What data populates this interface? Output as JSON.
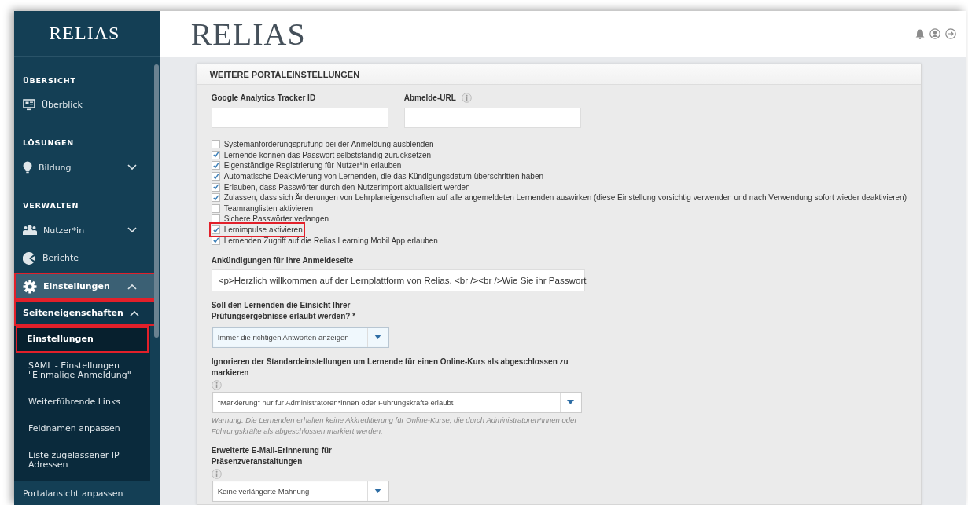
{
  "sidebar": {
    "logo": "RELIAS",
    "sections": [
      {
        "heading": "ÜBERSICHT",
        "items": [
          {
            "label": "Überblick",
            "kind": "link",
            "highlighted": false
          }
        ]
      },
      {
        "heading": "LÖSUNGEN",
        "items": [
          {
            "label": "Bildung",
            "kind": "group",
            "expanded": false,
            "highlighted": false
          }
        ]
      },
      {
        "heading": "VERWALTEN",
        "items": [
          {
            "label": "Nutzer*in",
            "kind": "group",
            "expanded": false,
            "highlighted": false
          },
          {
            "label": "Berichte",
            "kind": "link",
            "highlighted": false
          },
          {
            "label": "Einstellungen",
            "kind": "group",
            "expanded": true,
            "highlighted": true,
            "children": [
              {
                "label": "Seiteneigenschaften",
                "kind": "group",
                "expanded": true,
                "highlighted": true,
                "children": [
                  {
                    "label": "Einstellungen",
                    "selected": true,
                    "highlighted": true
                  },
                  {
                    "label": "SAML - Einstellungen \"Einmalige Anmeldung\"",
                    "selected": false,
                    "highlighted": false
                  },
                  {
                    "label": "Weiterführende Links",
                    "selected": false,
                    "highlighted": false
                  },
                  {
                    "label": "Feldnamen anpassen",
                    "selected": false,
                    "highlighted": false
                  },
                  {
                    "label": "Liste zugelassener IP-Adressen",
                    "selected": false,
                    "highlighted": false
                  }
                ]
              },
              {
                "label": "Portalansicht anpassen",
                "kind": "link",
                "highlighted": false
              }
            ]
          }
        ]
      }
    ]
  },
  "header": {
    "logo": "RELIAS"
  },
  "panel": {
    "title": "WEITERE PORTALEINSTELLUNGEN",
    "fields": [
      {
        "label": "Google Analytics Tracker ID",
        "info": false
      },
      {
        "label": "Abmelde-URL",
        "info": true
      }
    ],
    "checkboxes": [
      {
        "label": "Systemanforderungsprüfung bei der Anmeldung ausblenden",
        "checked": false,
        "highlighted": false
      },
      {
        "label": "Lernende können das Passwort selbstständig zurücksetzen",
        "checked": true,
        "highlighted": false
      },
      {
        "label": "Eigenständige Registrierung für Nutzer*in erlauben",
        "checked": true,
        "highlighted": false
      },
      {
        "label": "Automatische Deaktivierung von Lernenden, die das Kündigungsdatum überschritten haben",
        "checked": true,
        "highlighted": false
      },
      {
        "label": "Erlauben, dass Passwörter durch den Nutzerimport aktualisiert werden",
        "checked": true,
        "highlighted": false
      },
      {
        "label": "Zulassen, dass sich Änderungen von Lehrplaneigenschaften auf alle angemeldeten Lernenden auswirken (diese Einstellung vorsichtig verwenden und nach Verwendung sofort wieder deaktivieren)",
        "checked": true,
        "highlighted": false
      },
      {
        "label": "Teamranglisten aktivieren",
        "checked": false,
        "highlighted": false
      },
      {
        "label": "Sichere Passwörter verlangen",
        "checked": false,
        "highlighted": false
      },
      {
        "label": "Lernimpulse aktivieren",
        "checked": true,
        "highlighted": true
      },
      {
        "label": "Lernenden Zugriff auf die Relias Learning Mobil App erlauben",
        "checked": true,
        "highlighted": false
      }
    ],
    "announcement": {
      "label": "Ankündigungen für Ihre Anmeldeseite",
      "value": "<p>Herzlich willkommen auf der Lernplattform von Relias. <br /><br />Wie Sie ihr Passwort"
    },
    "selects": [
      {
        "label": "Soll den Lernenden die Einsicht Ihrer Prüfungsergebnisse erlaubt werden? *",
        "info": false,
        "value": "Immer die richtigen Antworten anzeigen",
        "focused": true
      },
      {
        "label": "Ignorieren der Standardeinstellungen um Lernende für einen Online-Kurs als abgeschlossen zu markieren",
        "info": true,
        "value": "\"Markierung\" nur für Administratoren*innen oder Führungskräfte erlaubt",
        "focused": false,
        "warning": "Warnung: Die Lernenden erhalten keine Akkreditierung für Online-Kurse, die durch Administratoren*innen oder Führungskräfte als abgeschlossen markiert werden."
      },
      {
        "label": "Erweiterte E-Mail-Erinnerung für Präsenzveranstaltungen",
        "info": true,
        "value": "Keine verlängerte Mahnung",
        "focused": false
      }
    ]
  }
}
